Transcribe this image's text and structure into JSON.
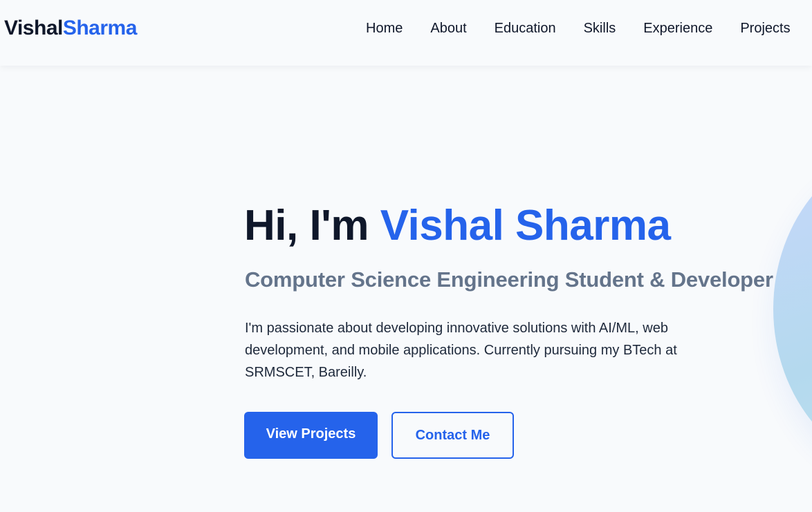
{
  "brand": {
    "first": "Vishal",
    "last": "Sharma"
  },
  "nav": {
    "items": [
      {
        "label": "Home"
      },
      {
        "label": "About"
      },
      {
        "label": "Education"
      },
      {
        "label": "Skills"
      },
      {
        "label": "Experience"
      },
      {
        "label": "Projects"
      }
    ]
  },
  "hero": {
    "greeting": "Hi, I'm ",
    "name": "Vishal Sharma",
    "subtitle": "Computer Science Engineering Student & Developer",
    "description": "I'm passionate about developing innovative solutions with AI/ML, web development, and mobile applications. Currently pursuing my BTech at SRMSCET, Bareilly.",
    "primary_button": "View Projects",
    "secondary_button": "Contact Me"
  },
  "colors": {
    "accent": "#2563eb",
    "text_dark": "#0f172a",
    "text_muted": "#64748b",
    "background": "#f8fafc"
  }
}
